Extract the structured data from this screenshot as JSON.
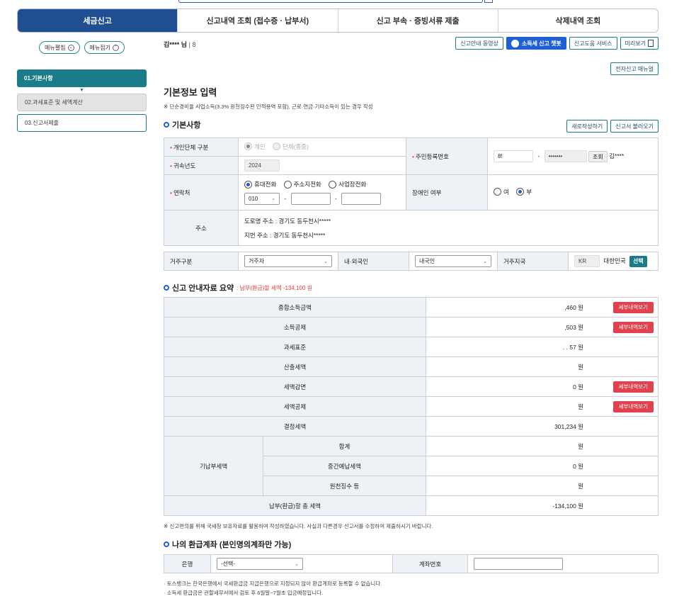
{
  "tabs": [
    "세금신고",
    "신고내역 조회 (접수증 · 납부서)",
    "신고 부속 · 증빙서류 제출",
    "삭제내역 조회"
  ],
  "sidebar": {
    "expand": "메뉴펼침",
    "collapse": "메뉴접기",
    "items": [
      "01.기본사항",
      "02.과세표준 및 세액계산",
      "03.신고서제출"
    ]
  },
  "user": {
    "name": "김**** 님",
    "sep": "|",
    "id": "8"
  },
  "topbuttons": [
    "신고안내 동영상",
    "소득세 신고 챗봇",
    "신고도움 서비스",
    "미리보기"
  ],
  "manual": "전자신고 매뉴얼",
  "title": "기본정보 입력",
  "note": "※ 단순경비율 사업소득(3.3% 원천징수된 인적용역 포함), 근로·연금·기타소득이 있는 경우 작성",
  "basic": {
    "heading": "기본사항",
    "new_btn": "새로작성하기",
    "load_btn": "신고서 불러오기",
    "type_label": "개인단체 구분",
    "type_opts": [
      "개인",
      "단체(종중)"
    ],
    "year_label": "귀속년도",
    "year": "2024",
    "rrn_label": "주민등록번호",
    "rrn_front": "8!",
    "rrn_back": "•••••••",
    "lookup": "조회",
    "rrn_name": "김****",
    "contact_label": "연락처",
    "contact_opts": [
      "휴대전화",
      "주소지전화",
      "사업장전화"
    ],
    "phone1": "010",
    "disabled_label": "장애인 여부",
    "disabled_opts": [
      "여",
      "부"
    ],
    "addr_label": "주소",
    "road": "도로명 주소 :   경기도 동두천시*****",
    "jibun": "지번 주소 :   경기도 동두천시*****",
    "res_label": "거주구분",
    "res_val": "거주자",
    "nat_label": "내·외국인",
    "nat_val": "내국인",
    "country_label": "거주지국",
    "country_code": "KR",
    "country_name": "대한민국",
    "select": "선택"
  },
  "summary": {
    "heading": "신고 안내자료 요약",
    "sub": ": 납부(환급)할 세액 -134,100 원",
    "detail": "세부내역보기",
    "rows": [
      {
        "label": "종합소득금액",
        "value": ",460  원",
        "btn": true
      },
      {
        "label": "소득공제",
        "value": ",503  원",
        "btn": true
      },
      {
        "label": "과세표준",
        "value": ".    .  57  원",
        "btn": false
      },
      {
        "label": "산출세액",
        "value": "원",
        "btn": false
      },
      {
        "label": "세액감면",
        "value": "0  원",
        "btn": true
      },
      {
        "label": "세액공제",
        "value": "원",
        "btn": true
      },
      {
        "label": "결정세액",
        "value": "301,234  원",
        "btn": false
      }
    ],
    "prepaid_label": "기납부세액",
    "prepaid": [
      {
        "label": "합계",
        "value": "원"
      },
      {
        "label": "중간예납세액",
        "value": "0  원"
      },
      {
        "label": "원천징수 등",
        "value": "원"
      }
    ],
    "total_label": "납부(환급)할 총 세액",
    "total": "-134,100  원"
  },
  "note2": "※ 신고편의를 위해 국세청 보유자료를 활용하여 작성하였습니다. 사실과 다른경우 신고서를 수정하여 제출하시기 바랍니다.",
  "refund": {
    "heading": "나의 환급계좌 (본인명의계좌만 가능)",
    "bank_label": "은행",
    "bank_val": "-선택-",
    "acct_label": "계좌번호"
  },
  "bullets": [
    "· 토스뱅크는 한국은행에서 국세환급금 지급은행으로 지정되지 않아 환급계좌로 등록할 수 없습니다.",
    "· 소득세 환급금은 관할세무서에서 검토 후 6월말~7월초 입금예정입니다."
  ]
}
